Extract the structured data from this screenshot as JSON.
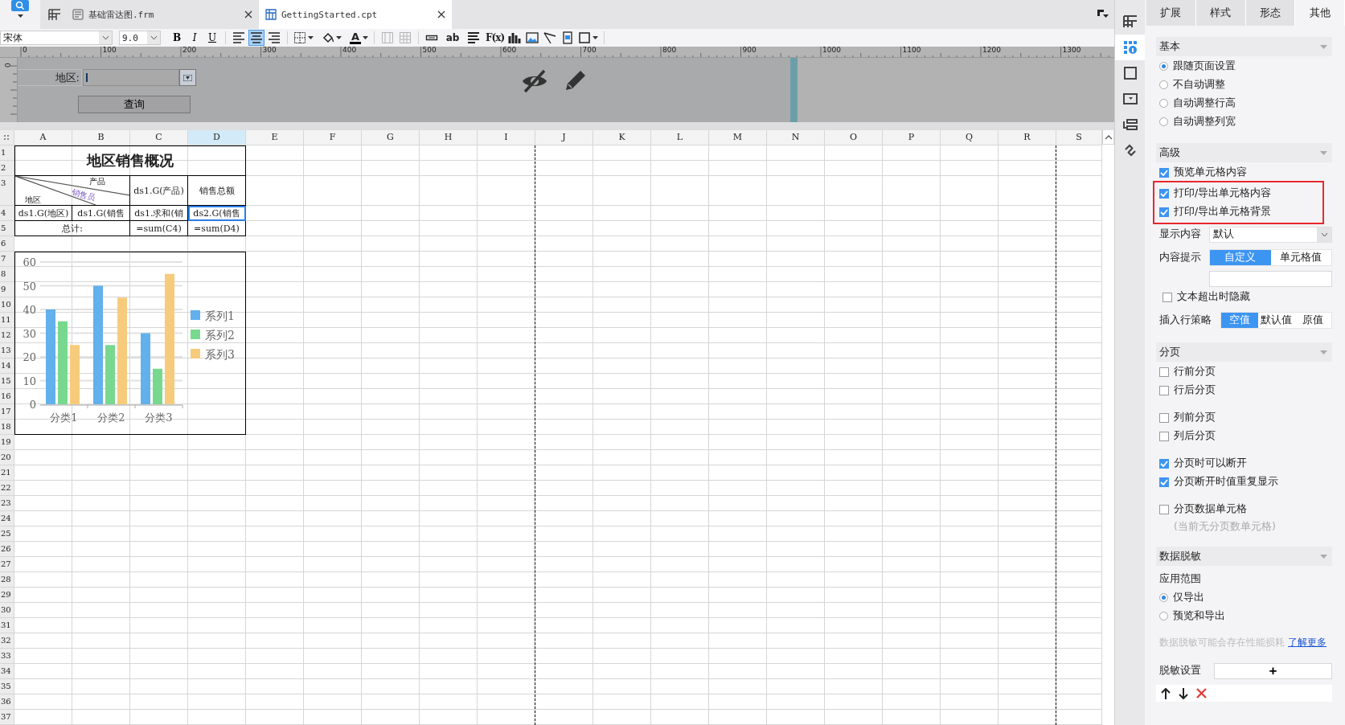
{
  "tabs": [
    {
      "label": "基础雷达图.frm",
      "selected": false,
      "kind": "form"
    },
    {
      "label": "GettingStarted.cpt",
      "selected": true,
      "kind": "report"
    }
  ],
  "toolbar": {
    "font": "宋体",
    "font_size": "9.0",
    "styles": [
      "B",
      "I",
      "U"
    ],
    "align": [
      {
        "selected": false
      },
      {
        "selected": true
      },
      {
        "selected": false
      }
    ],
    "font_color": "A",
    "merge": [
      {
        "disabled": true
      },
      {
        "disabled": true
      }
    ],
    "text_tool": "ab",
    "formula_tool": "F(x)"
  },
  "ruler": [
    "0",
    "100",
    "200",
    "300",
    "400",
    "500",
    "600",
    "700",
    "800",
    "900",
    "1000",
    "1100",
    "1200",
    "1300"
  ],
  "vertical_ruler": "0",
  "parameters": {
    "label": "地区:",
    "button": "查询"
  },
  "sheet": {
    "columns": [
      {
        "label": "A",
        "selected": false
      },
      {
        "label": "B",
        "selected": false
      },
      {
        "label": "C",
        "selected": false
      },
      {
        "label": "D",
        "selected": true
      },
      {
        "label": "E",
        "selected": false
      },
      {
        "label": "F",
        "selected": false
      },
      {
        "label": "G",
        "selected": false
      },
      {
        "label": "H",
        "selected": false
      },
      {
        "label": "I",
        "selected": false
      },
      {
        "label": "J",
        "selected": false
      },
      {
        "label": "K",
        "selected": false
      },
      {
        "label": "L",
        "selected": false
      },
      {
        "label": "M",
        "selected": false
      },
      {
        "label": "N",
        "selected": false
      },
      {
        "label": "O",
        "selected": false
      },
      {
        "label": "P",
        "selected": false
      },
      {
        "label": "Q",
        "selected": false
      },
      {
        "label": "R",
        "selected": false
      },
      {
        "label": "S",
        "selected": false
      }
    ],
    "rows": [
      "1",
      "2",
      "3",
      "4",
      "5",
      "6",
      "7",
      "8",
      "9",
      "10",
      "11",
      "12",
      "13",
      "14",
      "15",
      "16",
      "17",
      "18",
      "19",
      "20",
      "21",
      "22",
      "23",
      "24",
      "25",
      "26",
      "27",
      "28",
      "29",
      "30",
      "31",
      "32",
      "33",
      "34",
      "35",
      "36",
      "37"
    ],
    "cells": [
      {
        "kind": "title",
        "text": "地区销售概况",
        "selected": false
      },
      {
        "kind": "diagonal",
        "top": "产品",
        "middle": "销售员",
        "bottom": "地区",
        "selected": false
      },
      {
        "kind": "text",
        "text": "ds1.G(产品)",
        "selected": false
      },
      {
        "kind": "text",
        "text": "销售总额",
        "selected": false
      },
      {
        "kind": "text",
        "text": "ds1.G(地区)",
        "selected": false
      },
      {
        "kind": "text",
        "text": "ds1.G(销售",
        "selected": false
      },
      {
        "kind": "text",
        "text": "ds1.求和(销",
        "selected": false
      },
      {
        "kind": "text",
        "text": "ds2.G(销售",
        "selected": true
      },
      {
        "kind": "text",
        "text": "总计:",
        "selected": false
      },
      {
        "kind": "text",
        "text": "=sum(C4)",
        "selected": false
      },
      {
        "kind": "text",
        "text": "=sum(D4)",
        "selected": false
      },
      {
        "kind": "chart",
        "selected": false,
        "chart_data": {
          "type": "bar",
          "grid": true,
          "legend": "right",
          "categories": [
            "分类1",
            "分类2",
            "分类3"
          ],
          "series": [
            {
              "name": "系列1",
              "color": "#62b0ec",
              "values": [
                40,
                50,
                30
              ]
            },
            {
              "name": "系列2",
              "color": "#78d98e",
              "values": [
                35,
                25,
                15
              ]
            },
            {
              "name": "系列3",
              "color": "#f7cb7c",
              "values": [
                25,
                45,
                55
              ]
            }
          ],
          "ylim": [
            0,
            60
          ],
          "yticks": [
            0,
            10,
            20,
            30,
            40,
            50,
            60
          ]
        }
      }
    ]
  },
  "side_icons": [
    {
      "kind": "layout",
      "selected": false
    },
    {
      "kind": "cell",
      "selected": true
    },
    {
      "kind": "frame",
      "selected": false
    },
    {
      "kind": "widget",
      "selected": false
    },
    {
      "kind": "stack",
      "selected": false
    },
    {
      "kind": "link",
      "selected": false
    }
  ],
  "panel": {
    "tabs": [
      {
        "label": "扩展",
        "selected": false
      },
      {
        "label": "样式",
        "selected": false
      },
      {
        "label": "形态",
        "selected": false
      },
      {
        "label": "其他",
        "selected": true
      }
    ],
    "sections": [
      {
        "title": "基本",
        "groups": [
          {
            "kind": "plain",
            "items": [
              {
                "kind": "radio",
                "label": "跟随页面设置",
                "selected": true
              },
              {
                "kind": "radio",
                "label": "不自动调整",
                "selected": false
              },
              {
                "kind": "radio",
                "label": "自动调整行高",
                "selected": false
              },
              {
                "kind": "radio",
                "label": "自动调整列宽",
                "selected": false
              }
            ]
          }
        ]
      },
      {
        "title": "高级",
        "groups": [
          {
            "kind": "plain",
            "items": [
              {
                "kind": "checkbox",
                "label": "预览单元格内容",
                "checked": true
              }
            ]
          },
          {
            "kind": "highlight",
            "items": [
              {
                "kind": "checkbox",
                "label": "打印/导出单元格内容",
                "checked": true
              },
              {
                "kind": "checkbox",
                "label": "打印/导出单元格背景",
                "checked": true
              }
            ]
          },
          {
            "kind": "plain",
            "items": [
              {
                "kind": "select",
                "label": "显示内容",
                "value": "默认"
              },
              {
                "kind": "segmented",
                "label": "内容提示",
                "options": [
                  {
                    "label": "自定义",
                    "selected": true
                  },
                  {
                    "label": "单元格值",
                    "selected": false
                  }
                ]
              },
              {
                "kind": "input"
              },
              {
                "kind": "checkbox",
                "label": "文本超出时隐藏",
                "checked": false
              },
              {
                "kind": "segmented",
                "label": "插入行策略",
                "options": [
                  {
                    "label": "空值",
                    "selected": true
                  },
                  {
                    "label": "默认值",
                    "selected": false
                  },
                  {
                    "label": "原值",
                    "selected": false
                  }
                ]
              }
            ]
          }
        ]
      },
      {
        "title": "分页",
        "groups": [
          {
            "kind": "spaced",
            "items": [
              {
                "kind": "checkbox",
                "label": "行前分页",
                "checked": false
              },
              {
                "kind": "checkbox",
                "label": "行后分页",
                "checked": false
              }
            ]
          },
          {
            "kind": "spaced",
            "items": [
              {
                "kind": "checkbox",
                "label": "列前分页",
                "checked": false
              },
              {
                "kind": "checkbox",
                "label": "列后分页",
                "checked": false
              }
            ]
          },
          {
            "kind": "spaced",
            "items": [
              {
                "kind": "checkbox",
                "label": "分页时可以断开",
                "checked": true
              },
              {
                "kind": "checkbox",
                "label": "分页断开时值重复显示",
                "checked": true
              }
            ]
          },
          {
            "kind": "spaced",
            "items": [
              {
                "kind": "checkbox",
                "label": "分页数据单元格",
                "checked": false
              },
              {
                "kind": "note",
                "text": "(当前无分页数单元格)"
              }
            ]
          }
        ]
      },
      {
        "title": "数据脱敏",
        "groups": [
          {
            "kind": "plain",
            "items": [
              {
                "kind": "heading",
                "text": "应用范围"
              },
              {
                "kind": "radio",
                "label": "仅导出",
                "selected": true
              },
              {
                "kind": "radio",
                "label": "预览和导出",
                "selected": false
              },
              {
                "kind": "hint",
                "text": "数据脱敏可能会存在性能损耗",
                "link": "了解更多"
              },
              {
                "kind": "add",
                "label": "脱敏设置",
                "button": "+"
              },
              {
                "kind": "actions"
              }
            ]
          }
        ]
      }
    ]
  }
}
